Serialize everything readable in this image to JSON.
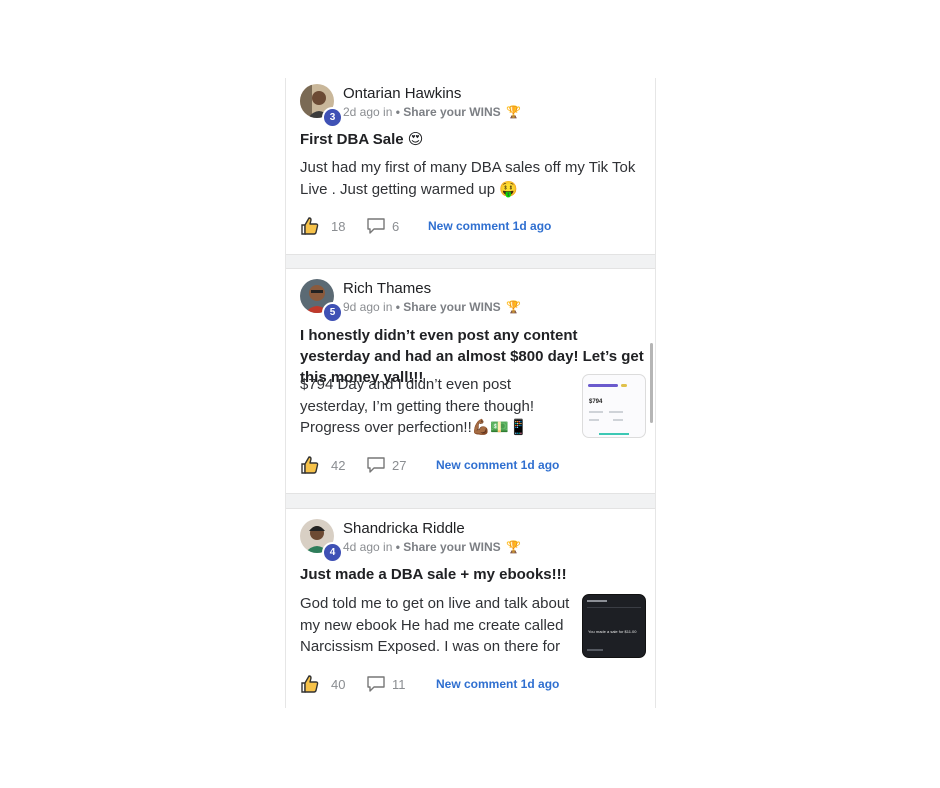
{
  "posts": [
    {
      "author": "Ontarian Hawkins",
      "level": "3",
      "time": "2d ago in",
      "category": "• Share your WINS",
      "trophy": "🏆",
      "title": "First DBA Sale 😍",
      "body": "Just had my first of many DBA sales off my Tik Tok Live . Just getting warmed up 🤑",
      "likes": "18",
      "comments": "6",
      "new_comment": "New comment 1d ago"
    },
    {
      "author": "Rich Thames",
      "level": "5",
      "time": "9d ago in",
      "category": "• Share your WINS",
      "trophy": "🏆",
      "title": "I honestly didn’t even post any content yesterday and had an almost $800 day! Let’s get this money yall!!!",
      "body": "$794 Day and I didn’t even post yesterday, I’m getting there though! Progress over perfection!!💪🏾💵📱",
      "thumb_amount": "$794",
      "likes": "42",
      "comments": "27",
      "new_comment": "New comment 1d ago"
    },
    {
      "author": "Shandricka Riddle",
      "level": "4",
      "time": "4d ago in",
      "category": "• Share your WINS",
      "trophy": "🏆",
      "title": "Just made a DBA sale + my ebooks!!!",
      "body": "God told me to get on live and talk about my new ebook He had me create called Narcissism Exposed. I was on there for",
      "thumb_text": "You made a sale for $11.00",
      "likes": "40",
      "comments": "11",
      "new_comment": "New comment 1d ago"
    }
  ],
  "colors": {
    "badge": "#3f51b5",
    "link": "#2f6fd0",
    "muted": "#8a8d91"
  }
}
